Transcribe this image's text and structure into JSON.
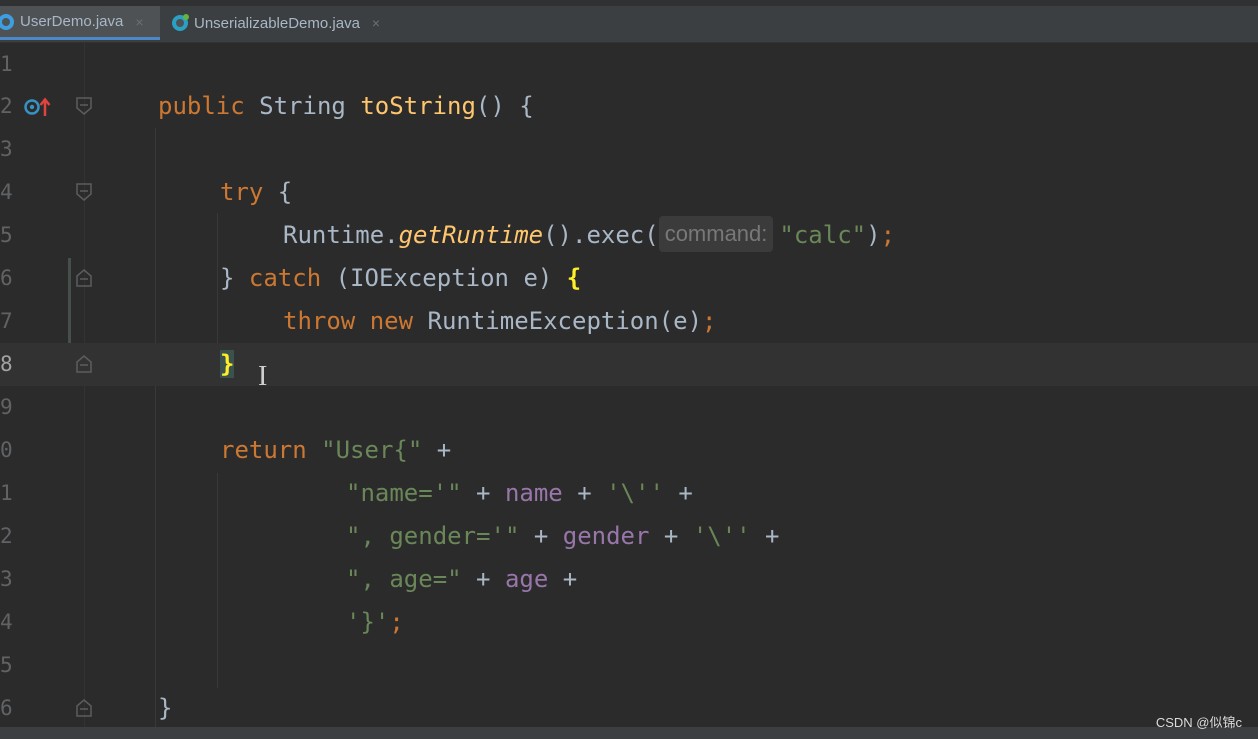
{
  "tabs": [
    {
      "label": "UserDemo.java",
      "active": true
    },
    {
      "label": "UnserializableDemo.java",
      "active": false
    }
  ],
  "tab_close_glyph": "×",
  "line_numbers": [
    "1",
    "2",
    "3",
    "4",
    "5",
    "6",
    "7",
    "8",
    "9",
    "0",
    "1",
    "2",
    "3",
    "4",
    "5",
    "6"
  ],
  "code": {
    "l2": {
      "kw": "public",
      "type": "String",
      "method": "toString",
      "rest": "() {"
    },
    "l4": {
      "kw": "try",
      "rest": " {"
    },
    "l5": {
      "a": "Runtime.",
      "method": "getRuntime",
      "b": "().exec(",
      "hint": "command:",
      "str": "\"calc\"",
      "c": ")",
      "semi": ";"
    },
    "l6": {
      "a": "} ",
      "kw": "catch",
      "b": " (IOException e) ",
      "brace": "{"
    },
    "l7": {
      "kw1": "throw",
      "kw2": "new",
      "b": " RuntimeException(e)",
      "semi": ";"
    },
    "l8": {
      "brace": "}"
    },
    "l10": {
      "kw": "return",
      "str": "\"User{\"",
      "rest": " +"
    },
    "l11": {
      "str1": "\"name='\"",
      "op1": " + ",
      "field": "name",
      "op2": " + ",
      "str2": "'\\''",
      "rest": " +"
    },
    "l12": {
      "str1": "\", gender='\"",
      "op1": " + ",
      "field": "gender",
      "op2": " + ",
      "str2": "'\\''",
      "rest": " +"
    },
    "l13": {
      "str1": "\", age=\"",
      "op1": " + ",
      "field": "age",
      "rest": " +"
    },
    "l14": {
      "str1": "'}'",
      "semi": ";"
    },
    "l16": {
      "rest": "}"
    }
  },
  "icons": {
    "override": "override-method-icon",
    "fold": "fold-marker-icon",
    "file": "java-class-file-icon"
  },
  "colors": {
    "background": "#2b2b2b",
    "keyword": "#cc7832",
    "method": "#ffc66d",
    "string": "#6a8759",
    "field": "#9876aa",
    "text": "#a9b7c6",
    "tab_accent": "#4a88c7"
  },
  "watermark": "CSDN @似锦c"
}
